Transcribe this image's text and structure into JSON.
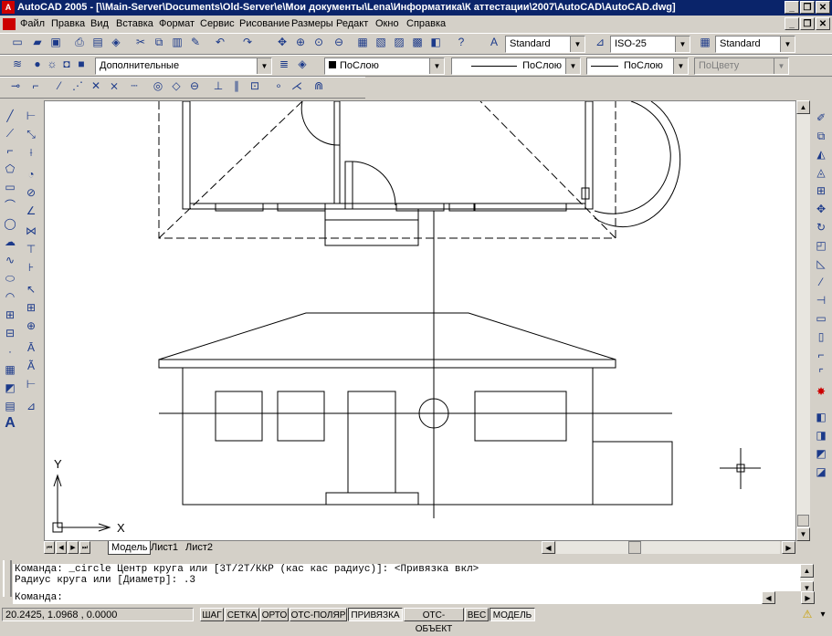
{
  "window": {
    "title": "AutoCAD 2005 - [\\\\Main-Server\\Documents\\Old-Server\\e\\Мои документы\\Lena\\Информатика\\К аттестации\\2007\\AutoCAD\\AutoCAD.dwg]",
    "app_icon": "A"
  },
  "menu": [
    "Файл",
    "Правка",
    "Вид",
    "Вставка",
    "Формат",
    "Сервис",
    "Рисование",
    "Размеры",
    "Редакт",
    "Окно",
    "Справка"
  ],
  "styles": {
    "text_style": "Standard",
    "dim_style": "ISO-25",
    "table_style": "Standard"
  },
  "layers": {
    "current_layer": "Дополнительные",
    "color": "ПоСлою",
    "linetype": "ПоСлою",
    "lineweight": "ПоСлою",
    "plotstyle": "ПоЦвету"
  },
  "ucs": {
    "x_label": "X",
    "y_label": "Y"
  },
  "tabs": [
    "Модель",
    "Лист1",
    "Лист2"
  ],
  "command": {
    "line1": "Команда: _circle Центр круга или [3Т/2Т/ККР (кас кас радиус)]:  <Привязка вкл>",
    "line2": "Радиус круга или [Диаметр]: .3",
    "prompt": "Команда:"
  },
  "status": {
    "coords": "20.2425, 1.0968 , 0.0000",
    "buttons": [
      "ШАГ",
      "СЕТКА",
      "ОРТО",
      "ОТС-ПОЛЯР",
      "ПРИВЯЗКА",
      "ОТС-ОБЪЕКТ",
      "ВЕС",
      "МОДЕЛЬ"
    ],
    "active": [
      "ПРИВЯЗКА",
      "МОДЕЛЬ"
    ]
  },
  "icons": {
    "window_controls": [
      "minimize-icon",
      "restore-icon",
      "close-icon"
    ],
    "scroll": [
      "scroll-up-icon",
      "scroll-down-icon",
      "scroll-left-icon",
      "scroll-right-icon"
    ]
  }
}
